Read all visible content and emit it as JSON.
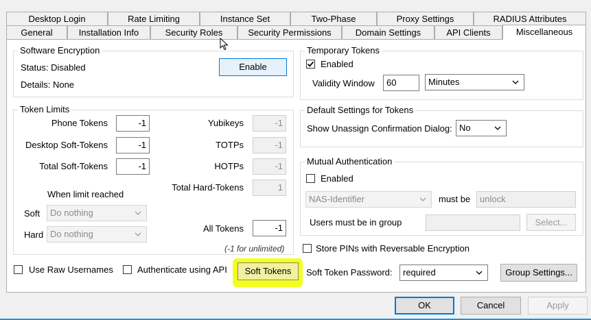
{
  "tabs_row1": [
    "Desktop Login",
    "Rate Limiting",
    "Instance Set",
    "Two-Phase",
    "Proxy Settings",
    "RADIUS Attributes"
  ],
  "tabs_row2": [
    "General",
    "Installation Info",
    "Security Roles",
    "Security Permissions",
    "Domain Settings",
    "API Clients",
    "Miscellaneous"
  ],
  "software_encryption": {
    "title": "Software Encryption",
    "status": "Status: Disabled",
    "details": "Details: None",
    "enable_button": "Enable"
  },
  "token_limits": {
    "title": "Token Limits",
    "phone_label": "Phone Tokens",
    "phone_value": "-1",
    "desktop_label": "Desktop Soft-Tokens",
    "desktop_value": "-1",
    "total_soft_label": "Total Soft-Tokens",
    "total_soft_value": "-1",
    "yubikeys_label": "Yubikeys",
    "yubikeys_value": "-1",
    "totps_label": "TOTPs",
    "totps_value": "-1",
    "hotps_label": "HOTPs",
    "hotps_value": "-1",
    "total_hard_label": "Total Hard-Tokens",
    "total_hard_value": "1",
    "when_limit": "When limit reached",
    "soft_label": "Soft",
    "soft_action": "Do nothing",
    "hard_label": "Hard",
    "hard_action": "Do nothing",
    "all_label": "All Tokens",
    "all_value": "-1",
    "unlimited_note": "(-1 for unlimited)"
  },
  "temporary_tokens": {
    "title": "Temporary Tokens",
    "enabled_label": "Enabled",
    "validity_label": "Validity Window",
    "validity_value": "60",
    "unit": "Minutes"
  },
  "default_settings": {
    "title": "Default Settings for Tokens",
    "unassign_label": "Show Unassign Confirmation Dialog:",
    "unassign_value": "No"
  },
  "mutual_auth": {
    "title": "Mutual Authentication",
    "enabled_label": "Enabled",
    "attribute": "NAS-Identifier",
    "must_be_label": "must be",
    "must_be_value": "unlock",
    "group_label": "Users must be in group",
    "group_value": "",
    "select_button": "Select..."
  },
  "store_pins_label": "Store PINs with Reversable Encryption",
  "use_raw_label": "Use Raw Usernames",
  "authenticate_api_label": "Authenticate using API",
  "soft_tokens_button": "Soft Tokens",
  "soft_token_password_label": "Soft Token Password:",
  "soft_token_password_value": "required",
  "group_settings_button": "Group Settings...",
  "ok_button": "OK",
  "cancel_button": "Cancel",
  "apply_button": "Apply",
  "colors": {
    "highlight": "#f5ff1f",
    "accent": "#0078d7",
    "check": "#000000"
  }
}
